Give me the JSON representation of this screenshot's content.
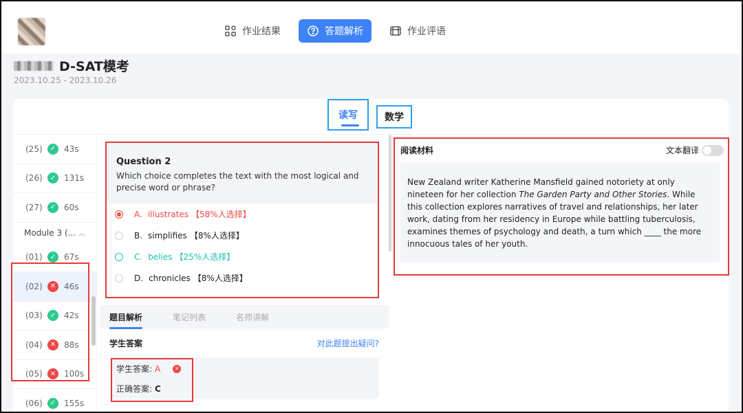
{
  "nav": {
    "items": [
      {
        "label": "作业结果",
        "icon": "grid-icon",
        "active": false
      },
      {
        "label": "答题解析",
        "icon": "question-circle-icon",
        "active": true
      },
      {
        "label": "作业评语",
        "icon": "comment-icon",
        "active": false
      }
    ]
  },
  "header": {
    "title": "D-SAT模考",
    "date_range": "2023.10.25 - 2023.10.26"
  },
  "subjects": {
    "reading": "读写",
    "math": "数学"
  },
  "question_list": {
    "rows_top": [
      {
        "num": "(25)",
        "status": "correct",
        "time": "43s"
      },
      {
        "num": "(26)",
        "status": "correct",
        "time": "131s"
      },
      {
        "num": "(27)",
        "status": "correct",
        "time": "60s"
      }
    ],
    "module_label": "Module 3 (...",
    "rows_bottom": [
      {
        "num": "(01)",
        "status": "correct",
        "time": "67s"
      },
      {
        "num": "(02)",
        "status": "wrong",
        "time": "46s"
      },
      {
        "num": "(03)",
        "status": "correct",
        "time": "42s"
      },
      {
        "num": "(04)",
        "status": "wrong",
        "time": "88s"
      },
      {
        "num": "(05)",
        "status": "wrong",
        "time": "100s"
      },
      {
        "num": "(06)",
        "status": "correct",
        "time": "155s"
      }
    ]
  },
  "question": {
    "title": "Question 2",
    "text": "Which choice completes the text with the most logical and precise word or phrase?",
    "options": [
      {
        "letter": "A.",
        "text": "illustrates",
        "pct": "【58%人选择】",
        "state": "selected-wrong"
      },
      {
        "letter": "B.",
        "text": "simplifies",
        "pct": "【8%人选择】",
        "state": "normal"
      },
      {
        "letter": "C.",
        "text": "belies",
        "pct": "【25%人选择】",
        "state": "correct"
      },
      {
        "letter": "D.",
        "text": "chronicles",
        "pct": "【8%人选择】",
        "state": "normal"
      }
    ]
  },
  "analysis": {
    "tabs": [
      "题目解析",
      "笔记列表",
      "名师讲解"
    ],
    "student_answer_title": "学生答案",
    "question_link": "对此题提出疑问?",
    "student_answer_label": "学生答案:",
    "student_answer_value": "A",
    "correct_answer_label": "正确答案:",
    "correct_answer_value": "C"
  },
  "reading": {
    "title": "阅读材料",
    "translate_label": "文本翻译",
    "translate_on": false,
    "passage_before": "New Zealand writer Katherine Mansfield gained notoriety at only nineteen for her collection ",
    "passage_italic": "The Garden Party and Other Stories",
    "passage_after": ". While this collection explores narratives of travel and relationships, her later work, dating from her residency in Europe while battling tuberculosis, examines themes of psychology and death, a turn which ____ the more innocuous tales of her youth."
  },
  "colors": {
    "accent": "#3d82f7",
    "correct": "#2ec98e",
    "wrong": "#ef4646",
    "teal": "#1bbfb3",
    "highlight_box": "#e33a3a"
  }
}
